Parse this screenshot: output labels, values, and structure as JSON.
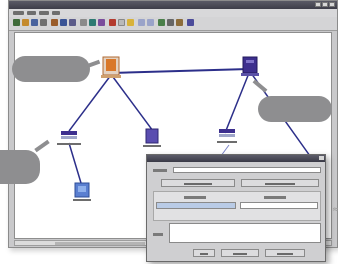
{
  "window": {
    "title": ""
  },
  "colors": {
    "link_line": "#2c2f8a",
    "link_line_light": "#7c84c8",
    "node_orange": "#d9782a",
    "node_purple": "#3d2f8e",
    "node_blue": "#5a7fd1",
    "callout_grey": "#8e8e90",
    "dialog_bg": "#cfcfd1",
    "selection_blue": "#b9cbe6"
  },
  "icons": {
    "server_orange": "server-orange-icon",
    "server_purple": "server-purple-icon",
    "workstation": "workstation-icon",
    "close": "close-icon"
  },
  "footnote": "≈"
}
